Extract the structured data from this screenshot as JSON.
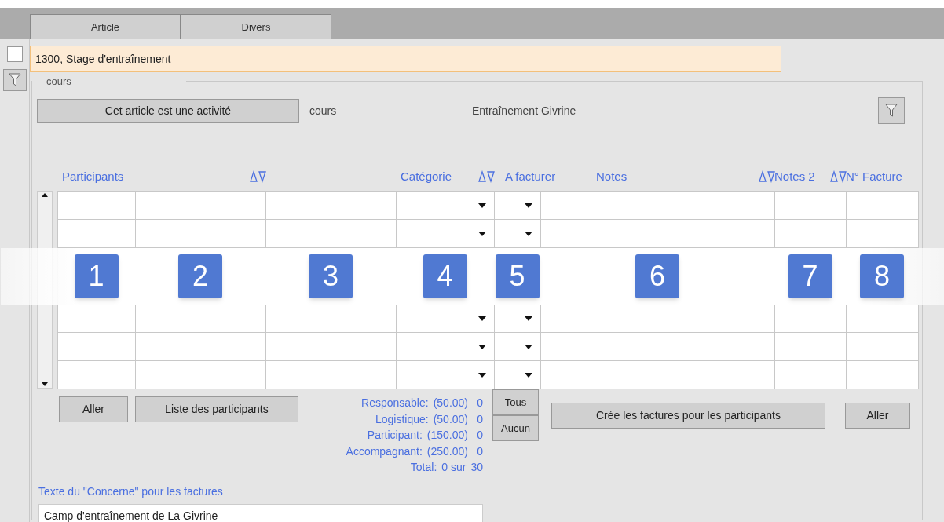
{
  "tabs": [
    {
      "label": "Article",
      "selected": false
    },
    {
      "label": "Divers",
      "selected": false
    }
  ],
  "record": {
    "checked": false,
    "title": "1300, Stage d'entraînement"
  },
  "group": {
    "title": "cours",
    "activity_button": "Cet article est une activité",
    "type": "cours",
    "activity_name": "Entraînement Givrine"
  },
  "columns": [
    {
      "label": "Participants",
      "sortable": false,
      "kind": "text"
    },
    {
      "sortable": true,
      "kind": "text"
    },
    {
      "sortable": false,
      "kind": "text"
    },
    {
      "label": "Catégorie",
      "sortable": true,
      "kind": "dropdown"
    },
    {
      "label": "A facturer",
      "sortable": false,
      "kind": "dropdown"
    },
    {
      "label": "Notes",
      "sortable": true,
      "kind": "text"
    },
    {
      "label": "Notes 2",
      "sortable": true,
      "kind": "text"
    },
    {
      "label": "N° Facture",
      "sortable": false,
      "kind": "text"
    }
  ],
  "annotations": [
    "1",
    "2",
    "3",
    "4",
    "5",
    "6",
    "7",
    "8"
  ],
  "left_buttons": [
    "Aller",
    "Liste des participants"
  ],
  "summary": [
    {
      "label": "Responsable:",
      "price": "(50.00)",
      "count": "0"
    },
    {
      "label": "Logistique:",
      "price": "(50.00)",
      "count": "0"
    },
    {
      "label": "Participant:",
      "price": "(150.00)",
      "count": "0"
    },
    {
      "label": "Accompagnant:",
      "price": "(250.00)",
      "count": "0"
    }
  ],
  "total": {
    "label": "Total:",
    "value": "0 sur",
    "max": "30"
  },
  "select_buttons": [
    "Tous",
    "Aucun"
  ],
  "invoice_button": "Crée les factures pour les participants",
  "go_button": "Aller",
  "concerne": {
    "label": "Texte du \"Concerne\" pour les factures",
    "value": "Camp d'entraînement de La Givrine"
  }
}
